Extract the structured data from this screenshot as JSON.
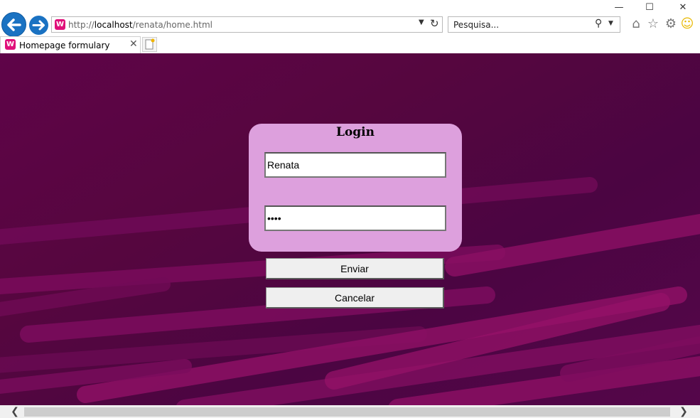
{
  "browser": {
    "address": {
      "prefix": "http://",
      "host": "localhost",
      "path": "/renata/home.html"
    },
    "search_placeholder": "Pesquisa...",
    "tab_title": "Homepage formulary",
    "site_icon_letter": "W"
  },
  "login": {
    "title": "Login",
    "username_value": "Renata",
    "password_value": "1234",
    "submit_label": "Enviar",
    "cancel_label": "Cancelar"
  },
  "colors": {
    "page_bg": "#560545",
    "card_bg": "#dda0dd",
    "stripe": "#8a0f63"
  }
}
